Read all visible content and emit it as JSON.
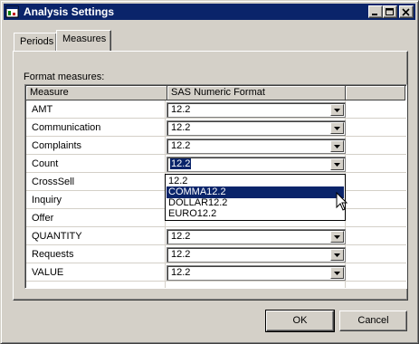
{
  "window": {
    "title": "Analysis Settings",
    "controls": [
      "minimize-icon",
      "maximize-icon",
      "close-icon"
    ]
  },
  "tabs": [
    {
      "label": "Periods",
      "selected": false
    },
    {
      "label": "Measures",
      "selected": true
    }
  ],
  "panel": {
    "group_label": "Format measures:",
    "columns": [
      "Measure",
      "SAS Numeric Format"
    ],
    "rows": [
      {
        "measure": "AMT",
        "format": "12.2"
      },
      {
        "measure": "Communication",
        "format": "12.2"
      },
      {
        "measure": "Complaints",
        "format": "12.2"
      },
      {
        "measure": "Count",
        "format": "12.2",
        "active": true
      },
      {
        "measure": "CrossSell",
        "format": ""
      },
      {
        "measure": "Inquiry",
        "format": ""
      },
      {
        "measure": "Offer",
        "format": ""
      },
      {
        "measure": "QUANTITY",
        "format": "12.2"
      },
      {
        "measure": "Requests",
        "format": "12.2"
      },
      {
        "measure": "VALUE",
        "format": "12.2"
      }
    ],
    "dropdown": {
      "options": [
        "12.2",
        "COMMA12.2",
        "DOLLAR12.2",
        "EURO12.2"
      ],
      "highlighted": "COMMA12.2"
    }
  },
  "buttons": {
    "ok": "OK",
    "cancel": "Cancel"
  },
  "colors": {
    "titlebar": "#0a246a",
    "face": "#d4d0c8",
    "highlight": "#0a246a"
  }
}
